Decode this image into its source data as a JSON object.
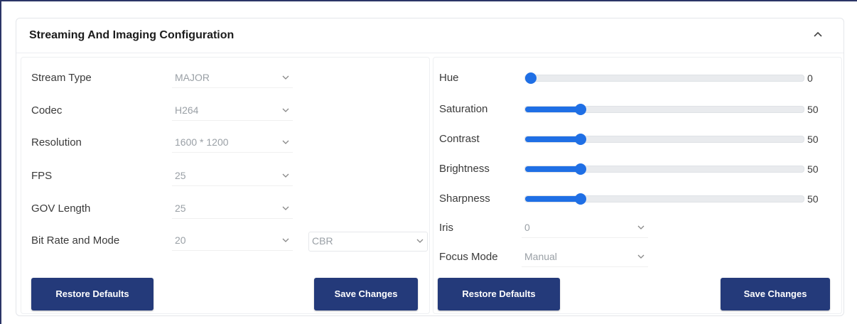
{
  "card": {
    "title": "Streaming And Imaging Configuration"
  },
  "icons": {
    "collapse": "chevron-up-icon",
    "select": "chevron-down-icon"
  },
  "colors": {
    "button": "#243a7a",
    "slider": "#1f6fe5",
    "frame": "#2b3566"
  },
  "left": {
    "stream_type": {
      "label": "Stream Type",
      "value": "MAJOR"
    },
    "codec": {
      "label": "Codec",
      "value": "H264"
    },
    "resolution": {
      "label": "Resolution",
      "value": "1600 * 1200"
    },
    "fps": {
      "label": "FPS",
      "value": "25"
    },
    "gov_length": {
      "label": "GOV Length",
      "value": "25"
    },
    "bit_rate": {
      "label": "Bit Rate and Mode",
      "value": "20",
      "mode": "CBR"
    },
    "restore_label": "Restore Defaults",
    "save_label": "Save Changes"
  },
  "right": {
    "hue": {
      "label": "Hue",
      "value": "0",
      "fraction": 0.0
    },
    "saturation": {
      "label": "Saturation",
      "value": "50",
      "fraction": 0.2
    },
    "contrast": {
      "label": "Contrast",
      "value": "50",
      "fraction": 0.2
    },
    "brightness": {
      "label": "Brightness",
      "value": "50",
      "fraction": 0.2
    },
    "sharpness": {
      "label": "Sharpness",
      "value": "50",
      "fraction": 0.2
    },
    "iris": {
      "label": "Iris",
      "value": "0"
    },
    "focus_mode": {
      "label": "Focus Mode",
      "value": "Manual"
    },
    "restore_label": "Restore Defaults",
    "save_label": "Save Changes"
  }
}
